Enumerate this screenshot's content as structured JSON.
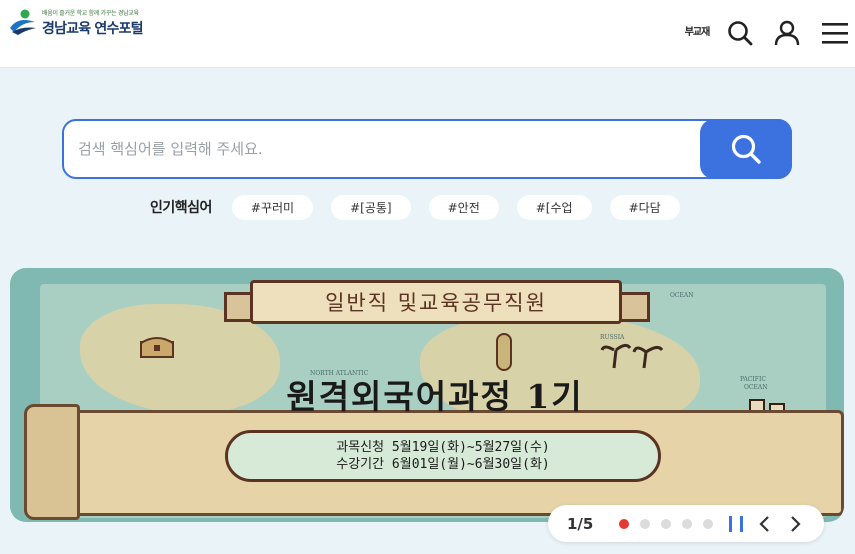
{
  "header": {
    "logo_slogan": "배움이 즐거운 학교 함께 가꾸는 경남교육",
    "logo_name": "경남교육 연수포털",
    "bugo_label": "부교재",
    "icons": [
      "bugo-icon",
      "search-icon",
      "user-icon",
      "hamburger-menu-icon"
    ]
  },
  "search": {
    "placeholder": "검색 핵심어를 입력해 주세요."
  },
  "popular": {
    "label": "인기핵심어",
    "tags": [
      "#꾸러미",
      "#[공통]",
      "#안전",
      "#[수업",
      "#다담"
    ]
  },
  "banner": {
    "ribbon_text": "일반직 및교육공무직원",
    "title": "원격외국어과정 1기",
    "line1": "과목신청 5월19일(화)~5월27일(수)",
    "line2": "수강기간 6월01일(월)~6월30일(화)",
    "map_labels": [
      "NORTH ATLANTIC",
      "OCEAN",
      "PACIFIC",
      "OCEAN",
      "RUSSIA"
    ]
  },
  "slider": {
    "counter": "1/5",
    "current": 1,
    "total": 5,
    "active_color": "#e53935"
  },
  "colors": {
    "accent": "#3b72e0",
    "background": "#eaf4f8"
  }
}
